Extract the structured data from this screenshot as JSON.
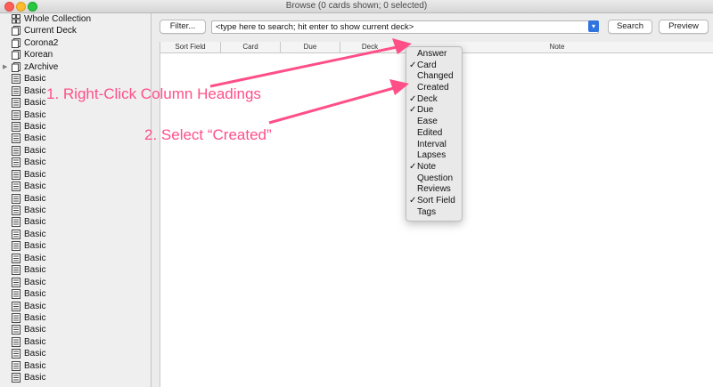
{
  "window": {
    "title": "Browse (0 cards shown; 0 selected)"
  },
  "sidebar": {
    "items": [
      {
        "label": "Whole Collection",
        "icon": "collection-icon",
        "expand": false
      },
      {
        "label": "Current Deck",
        "icon": "deck-icon",
        "expand": false
      },
      {
        "label": "Corona2",
        "icon": "deck-icon",
        "expand": false
      },
      {
        "label": "Korean",
        "icon": "deck-icon",
        "expand": false
      },
      {
        "label": "zArchive",
        "icon": "deck-icon",
        "expand": true
      },
      {
        "label": "Basic",
        "icon": "note-type-icon",
        "expand": false
      },
      {
        "label": "Basic",
        "icon": "note-type-icon",
        "expand": false
      },
      {
        "label": "Basic",
        "icon": "note-type-icon",
        "expand": false
      },
      {
        "label": "Basic",
        "icon": "note-type-icon",
        "expand": false
      },
      {
        "label": "Basic",
        "icon": "note-type-icon",
        "expand": false
      },
      {
        "label": "Basic",
        "icon": "note-type-icon",
        "expand": false
      },
      {
        "label": "Basic",
        "icon": "note-type-icon",
        "expand": false
      },
      {
        "label": "Basic",
        "icon": "note-type-icon",
        "expand": false
      },
      {
        "label": "Basic",
        "icon": "note-type-icon",
        "expand": false
      },
      {
        "label": "Basic",
        "icon": "note-type-icon",
        "expand": false
      },
      {
        "label": "Basic",
        "icon": "note-type-icon",
        "expand": false
      },
      {
        "label": "Basic",
        "icon": "note-type-icon",
        "expand": false
      },
      {
        "label": "Basic",
        "icon": "note-type-icon",
        "expand": false
      },
      {
        "label": "Basic",
        "icon": "note-type-icon",
        "expand": false
      },
      {
        "label": "Basic",
        "icon": "note-type-icon",
        "expand": false
      },
      {
        "label": "Basic",
        "icon": "note-type-icon",
        "expand": false
      },
      {
        "label": "Basic",
        "icon": "note-type-icon",
        "expand": false
      },
      {
        "label": "Basic",
        "icon": "note-type-icon",
        "expand": false
      },
      {
        "label": "Basic",
        "icon": "note-type-icon",
        "expand": false
      },
      {
        "label": "Basic",
        "icon": "note-type-icon",
        "expand": false
      },
      {
        "label": "Basic",
        "icon": "note-type-icon",
        "expand": false
      },
      {
        "label": "Basic",
        "icon": "note-type-icon",
        "expand": false
      },
      {
        "label": "Basic",
        "icon": "note-type-icon",
        "expand": false
      },
      {
        "label": "Basic",
        "icon": "note-type-icon",
        "expand": false
      },
      {
        "label": "Basic",
        "icon": "note-type-icon",
        "expand": false
      },
      {
        "label": "Basic",
        "icon": "note-type-icon",
        "expand": false
      }
    ]
  },
  "toolbar": {
    "filter_label": "Filter...",
    "search_placeholder": "<type here to search; hit enter to show current deck>",
    "search_button": "Search",
    "preview_button": "Preview"
  },
  "table": {
    "columns": [
      "Sort Field",
      "Card",
      "Due",
      "Deck",
      "Note"
    ]
  },
  "context_menu": {
    "items": [
      {
        "label": "Answer",
        "checked": false
      },
      {
        "label": "Card",
        "checked": true
      },
      {
        "label": "Changed",
        "checked": false
      },
      {
        "label": "Created",
        "checked": false
      },
      {
        "label": "Deck",
        "checked": true
      },
      {
        "label": "Due",
        "checked": true
      },
      {
        "label": "Ease",
        "checked": false
      },
      {
        "label": "Edited",
        "checked": false
      },
      {
        "label": "Interval",
        "checked": false
      },
      {
        "label": "Lapses",
        "checked": false
      },
      {
        "label": "Note",
        "checked": true
      },
      {
        "label": "Question",
        "checked": false
      },
      {
        "label": "Reviews",
        "checked": false
      },
      {
        "label": "Sort Field",
        "checked": true
      },
      {
        "label": "Tags",
        "checked": false
      }
    ]
  },
  "annotations": {
    "step1": "1. Right-Click Column Headings",
    "step2": "2. Select “Created”",
    "color": "#ff4f88"
  }
}
